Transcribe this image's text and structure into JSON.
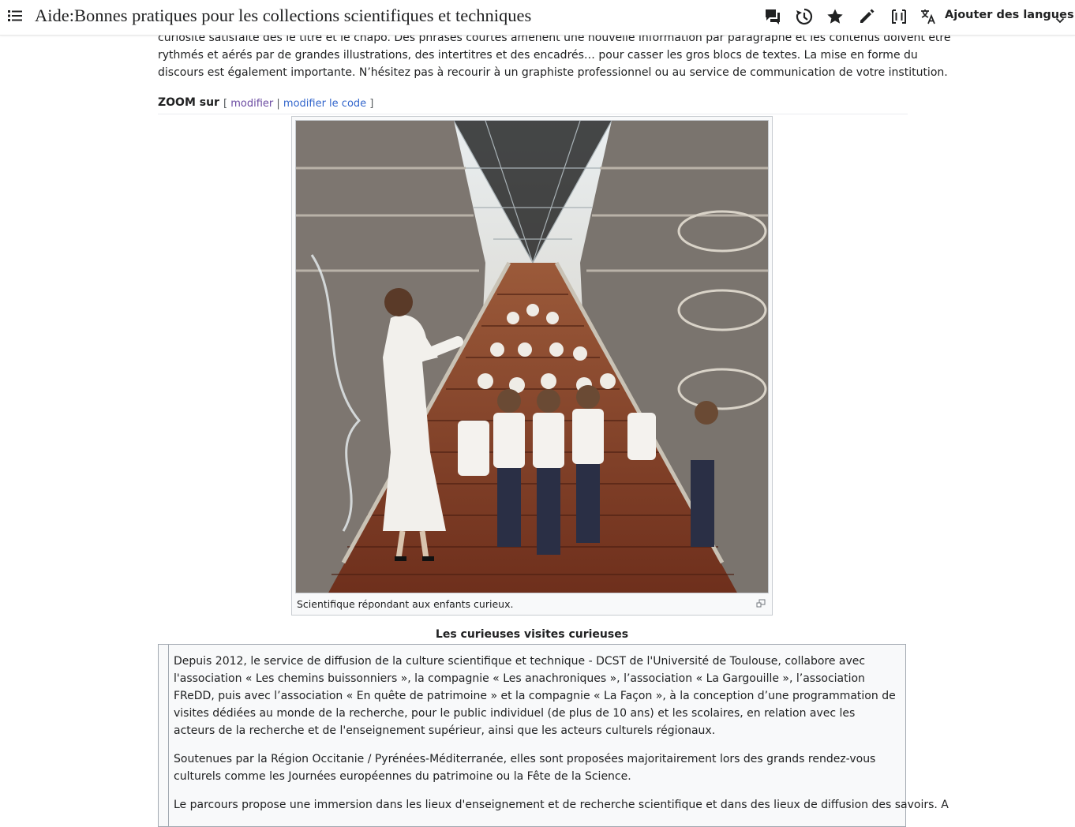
{
  "header": {
    "title": "Aide:Bonnes pratiques pour les collections scientifiques et techniques",
    "languages_label": "Ajouter des langues",
    "icons": [
      "menu-icon",
      "talk-icon",
      "history-icon",
      "watch-star-icon",
      "edit-pencil-icon",
      "wikitext-brackets-icon",
      "translate-icon",
      "chevron-down-icon"
    ]
  },
  "lead": {
    "line1": "curiosité satisfaite dès le titre et le chapo. Des phrases courtes amènent une nouvelle information par paragraphe et les contenus doivent être",
    "line2": "rythmés et aérés par de grandes illustrations, des intertitres et des encadrés… pour casser les gros blocs de textes. La mise en forme du",
    "line3": "discours est également importante. N’hésitez pas à recourir à un graphiste professionnel ou au service de communication de votre institution."
  },
  "section": {
    "heading": "ZOOM sur",
    "bracket_open": "[",
    "edit_label": "modifier",
    "separator": "|",
    "edit_source_label": "modifier le code",
    "bracket_close": "]"
  },
  "figure": {
    "caption": "Scientifique répondant aux enfants curieux."
  },
  "box": {
    "title": "Les curieuses visites curieuses",
    "paragraph1": "Depuis 2012, le service de diffusion de la culture scientifique et technique - DCST de l'Université de Toulouse, collabore avec l'association « Les chemins buissonniers », la compagnie « Les anachroniques », l’association « La Gargouille », l’association FReDD, puis avec l’association « En quête de patrimoine » et la compagnie « La Façon », à la conception d’une programmation de visites dédiées au monde de la recherche, pour le public individuel (de plus de 10 ans) et les scolaires, en relation avec les acteurs de la recherche et de l'enseignement supérieur, ainsi que les acteurs culturels régionaux.",
    "paragraph2": "Soutenues par la Région Occitanie / Pyrénées-Méditerranée, elles sont proposées majoritairement lors des grands rendez-vous culturels comme les Journées européennes du patrimoine ou la Fête de la Science.",
    "paragraph3": "Le parcours propose une immersion dans les lieux d'enseignement et de recherche scientifique et dans des lieux de diffusion des savoirs. A"
  },
  "colors": {
    "link": "#3366cc",
    "visited_link": "#6b4ba1",
    "text": "#202122",
    "border": "#a2a9b1"
  }
}
